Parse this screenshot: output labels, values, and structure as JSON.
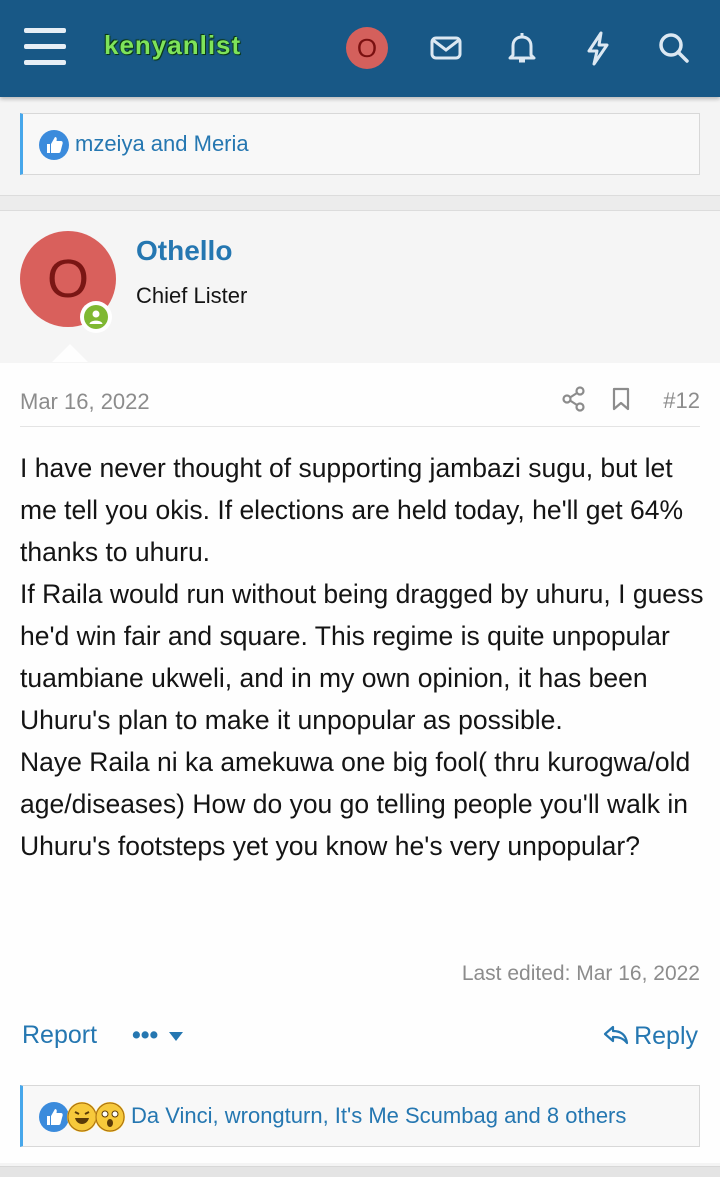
{
  "header": {
    "logo_text": "kenyanlist",
    "avatar_letter": "O",
    "icons": [
      "menu-icon",
      "mail-icon",
      "bell-icon",
      "lightning-icon",
      "search-icon"
    ]
  },
  "top_reactions": {
    "text": "mzeiya and Meria"
  },
  "post": {
    "author": "Othello",
    "author_title": "Chief Lister",
    "avatar_letter": "O",
    "date": "Mar 16, 2022",
    "number": "#12",
    "paragraphs": [
      "I have never thought of supporting jambazi sugu, but let me tell you okis. If elections are held today, he'll get 64% thanks to uhuru.",
      "If Raila would run without being dragged by uhuru, I guess he'd win fair and square. This regime is quite unpopular tuambiane ukweli, and in my own opinion, it has been Uhuru's plan to make it unpopular as possible.",
      "Naye Raila ni ka amekuwa one big fool( thru kurogwa/old age/diseases) How do you go telling people you'll walk in Uhuru's footsteps yet you know he's very unpopular?"
    ],
    "last_edited": "Last edited: Mar 16, 2022",
    "report_label": "Report",
    "more_label": "•••",
    "reply_label": "Reply",
    "reactions_text": "Da Vinci, wrongturn, It's Me Scumbag and 8 others"
  },
  "colors": {
    "header_bg": "#185886",
    "link": "#2577b1",
    "logo_green": "#7ee35a",
    "avatar_red": "#d9605c",
    "online_green": "#7fb832"
  }
}
